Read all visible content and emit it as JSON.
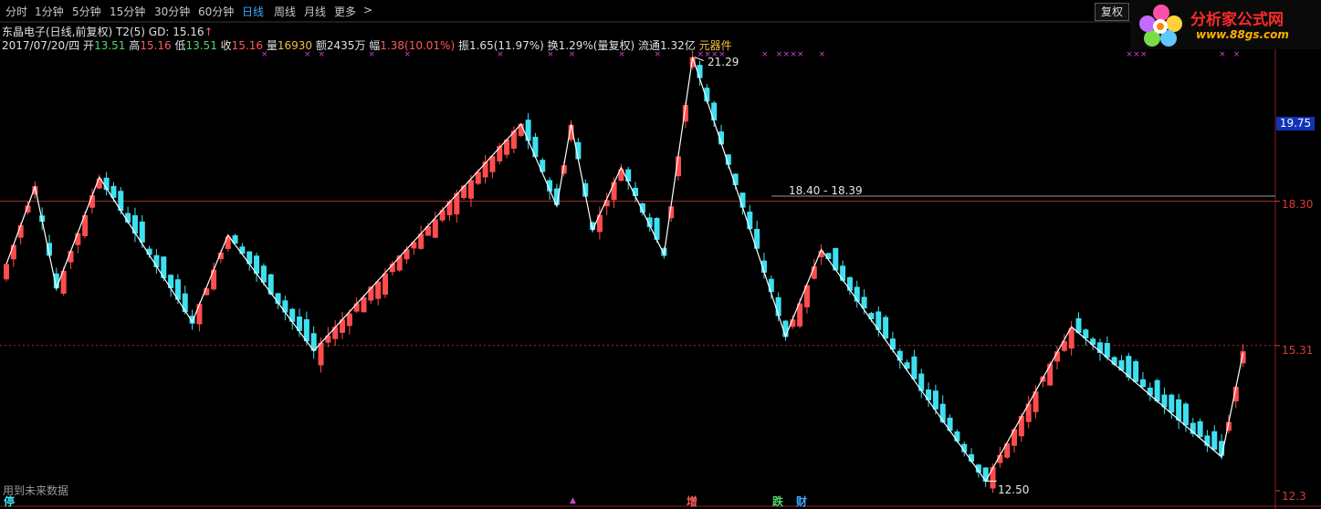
{
  "toolbar": {
    "tabs": [
      "分时",
      "1分钟",
      "5分钟",
      "15分钟",
      "30分钟",
      "60分钟",
      "日线",
      "周线",
      "月线",
      "更多"
    ],
    "active": "日线",
    "more_arrow": ">",
    "fuquan_button": "复权"
  },
  "info": {
    "title": "东晶电子(日线,前复权) T2(5)",
    "gd": "GD: 15.16",
    "date": "2017/07/20/四",
    "open_label": "开",
    "open": "13.51",
    "high_label": "高",
    "high": "15.16",
    "low_label": "低",
    "low": "13.51",
    "close_label": "收",
    "close": "15.16",
    "volume_label": "量",
    "volume": "16930",
    "amount_label": "额",
    "amount": "2435万",
    "range_label": "幅",
    "range": "1.38(10.01%)",
    "amplitude_label": "振",
    "amplitude": "1.65(11.97%)",
    "turnover_label": "换",
    "turnover": "1.29%(量复权)",
    "float_label": "流通",
    "float": "1.32亿",
    "sector": "元器件"
  },
  "logo": {
    "title": "分析家公式网",
    "url": "www.88gs.com"
  },
  "price_labels": {
    "peak": "21.29",
    "flat_range": "18.40 - 18.39",
    "bottom": "12.50"
  },
  "y_axis": {
    "current_price": "19.75",
    "ticks": [
      "18.30",
      "15.31",
      "12.3"
    ]
  },
  "footer": {
    "note": "用到未来数据",
    "marks": [
      "停",
      "增",
      "跌",
      "财"
    ]
  },
  "colors": {
    "up": "#ff4c4c",
    "down": "#3ee0f0",
    "zigzag": "#ffffff",
    "ref_line": "#a03030",
    "x_marker": "#d040d0"
  },
  "chart_data": {
    "type": "candlestick",
    "ylim": [
      12.3,
      21.3
    ],
    "reference_lines": [
      18.3,
      15.31
    ],
    "zigzag_turning_points": [
      {
        "bar": 0,
        "price": 17.0
      },
      {
        "bar": 4,
        "price": 18.6
      },
      {
        "bar": 7,
        "price": 16.5
      },
      {
        "bar": 13,
        "price": 18.8
      },
      {
        "bar": 26,
        "price": 15.8
      },
      {
        "bar": 31,
        "price": 17.6
      },
      {
        "bar": 43,
        "price": 15.2
      },
      {
        "bar": 72,
        "price": 19.9
      },
      {
        "bar": 77,
        "price": 18.2
      },
      {
        "bar": 79,
        "price": 19.9
      },
      {
        "bar": 82,
        "price": 17.7
      },
      {
        "bar": 86,
        "price": 19.0
      },
      {
        "bar": 92,
        "price": 17.2
      },
      {
        "bar": 96,
        "price": 21.29
      },
      {
        "bar": 109,
        "price": 15.5
      },
      {
        "bar": 114,
        "price": 17.3
      },
      {
        "bar": 137,
        "price": 12.5
      },
      {
        "bar": 149,
        "price": 15.7
      },
      {
        "bar": 170,
        "price": 13.0
      },
      {
        "bar": 173,
        "price": 15.16
      }
    ]
  }
}
